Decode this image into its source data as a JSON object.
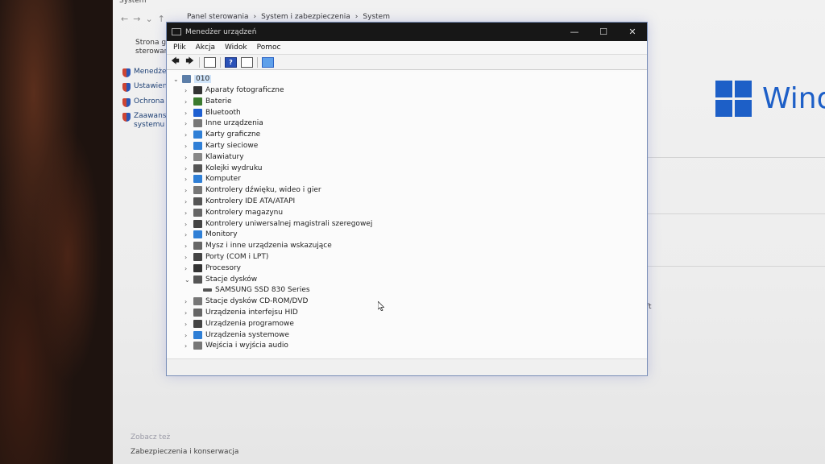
{
  "background_window": {
    "title": "System",
    "breadcrumb": [
      "Panel sterowania",
      "System i zabezpieczenia",
      "System"
    ],
    "left_text": [
      "Strona g",
      "sterowan"
    ],
    "left_links": [
      "Menedże",
      "Ustawien",
      "Ochrona",
      "Zaawanso",
      "systemu"
    ],
    "brand_text": "Wind",
    "partial_text": "ft",
    "see_also": "Zobacz też",
    "see_also_link": "Zabezpieczenia i konserwacja"
  },
  "window": {
    "title": "Menedżer urządzeń",
    "controls": {
      "minimize": "—",
      "maximize": "☐",
      "close": "✕"
    }
  },
  "menu": [
    "Plik",
    "Akcja",
    "Widok",
    "Pomoc"
  ],
  "toolbar": {
    "back": "🡄",
    "forward": "🡆",
    "help": "?"
  },
  "tree": {
    "root": "010",
    "items": [
      {
        "label": "Aparaty fotograficzne",
        "icon_color": "#333333"
      },
      {
        "label": "Baterie",
        "icon_color": "#3b7a2e"
      },
      {
        "label": "Bluetooth",
        "icon_color": "#1e5fd1"
      },
      {
        "label": "Inne urządzenia",
        "icon_color": "#777777"
      },
      {
        "label": "Karty graficzne",
        "icon_color": "#2f7fd6"
      },
      {
        "label": "Karty sieciowe",
        "icon_color": "#2f7fd6"
      },
      {
        "label": "Klawiatury",
        "icon_color": "#888888"
      },
      {
        "label": "Kolejki wydruku",
        "icon_color": "#555555"
      },
      {
        "label": "Komputer",
        "icon_color": "#2f7fd6"
      },
      {
        "label": "Kontrolery dźwięku, wideo i gier",
        "icon_color": "#777777"
      },
      {
        "label": "Kontrolery IDE ATA/ATAPI",
        "icon_color": "#555555"
      },
      {
        "label": "Kontrolery magazynu",
        "icon_color": "#666666"
      },
      {
        "label": "Kontrolery uniwersalnej magistrali szeregowej",
        "icon_color": "#444444"
      },
      {
        "label": "Monitory",
        "icon_color": "#2f7fd6"
      },
      {
        "label": "Mysz i inne urządzenia wskazujące",
        "icon_color": "#666666"
      },
      {
        "label": "Porty (COM i LPT)",
        "icon_color": "#444444"
      },
      {
        "label": "Procesory",
        "icon_color": "#333333"
      },
      {
        "label": "Stacje dysków",
        "icon_color": "#555555",
        "expanded": true,
        "children": [
          "SAMSUNG SSD 830 Series"
        ]
      },
      {
        "label": "Stacje dysków CD-ROM/DVD",
        "icon_color": "#777777"
      },
      {
        "label": "Urządzenia interfejsu HID",
        "icon_color": "#666666"
      },
      {
        "label": "Urządzenia programowe",
        "icon_color": "#444444"
      },
      {
        "label": "Urządzenia systemowe",
        "icon_color": "#2f7fd6"
      },
      {
        "label": "Wejścia i wyjścia audio",
        "icon_color": "#777777"
      }
    ]
  }
}
